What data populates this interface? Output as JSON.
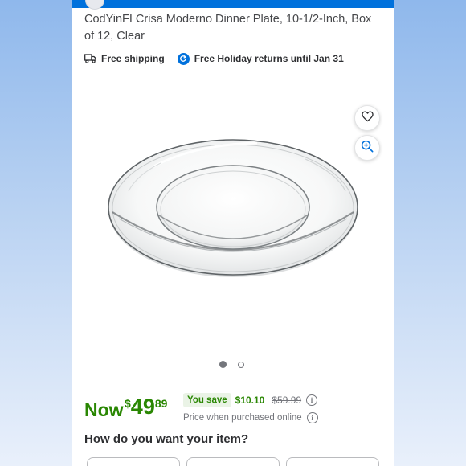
{
  "product": {
    "title": "CodYinFI Crisa Moderno Dinner Plate, 10-1/2-Inch, Box of 12, Clear"
  },
  "badges": {
    "shipping": "Free shipping",
    "returns": "Free Holiday returns until Jan 31"
  },
  "image": {
    "alt": "Clear glass dinner plate",
    "carousel": {
      "current": 1,
      "total": 2
    }
  },
  "actions": {
    "favorite_icon": "heart-icon",
    "zoom_icon": "zoom-in-icon"
  },
  "price": {
    "now_label": "Now",
    "currency": "$",
    "dollars": "49",
    "cents": "89",
    "you_save_label": "You save",
    "save_amount": "$10.10",
    "was_price": "$59.99",
    "online_note": "Price when purchased online"
  },
  "fulfillment": {
    "question": "How do you want your item?"
  },
  "colors": {
    "brand_blue": "#0071dc",
    "price_green": "#2a8703",
    "save_bg": "#eaf3e6",
    "muted": "#74767c"
  }
}
